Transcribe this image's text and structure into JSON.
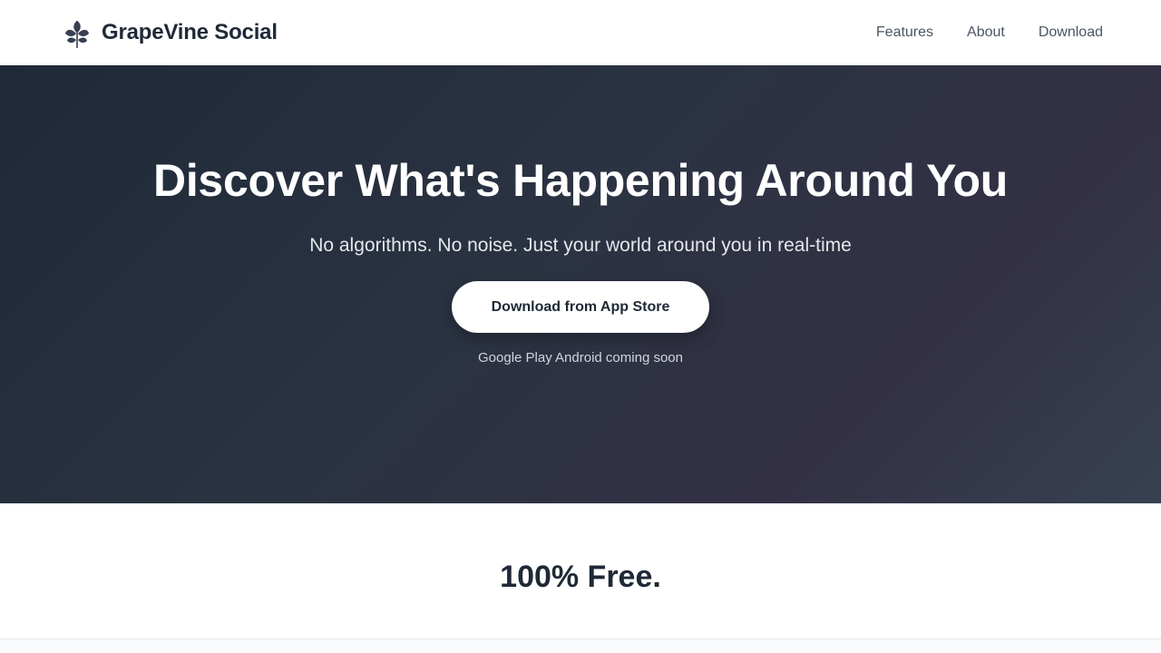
{
  "navbar": {
    "brand_name": "GrapeVine Social",
    "logo_icon": "leaf-sprig-icon",
    "links": [
      {
        "label": "Features"
      },
      {
        "label": "About"
      },
      {
        "label": "Download"
      }
    ]
  },
  "hero": {
    "title": "Discover What's Happening Around You",
    "subtitle": "No algorithms. No noise. Just your world around you in real-time",
    "cta_label": "Download from App Store",
    "note": "Google Play Android coming soon"
  },
  "pricing": {
    "title": "100% Free."
  },
  "colors": {
    "dark": "#1f2937",
    "hero_end": "#374151",
    "white": "#ffffff"
  }
}
